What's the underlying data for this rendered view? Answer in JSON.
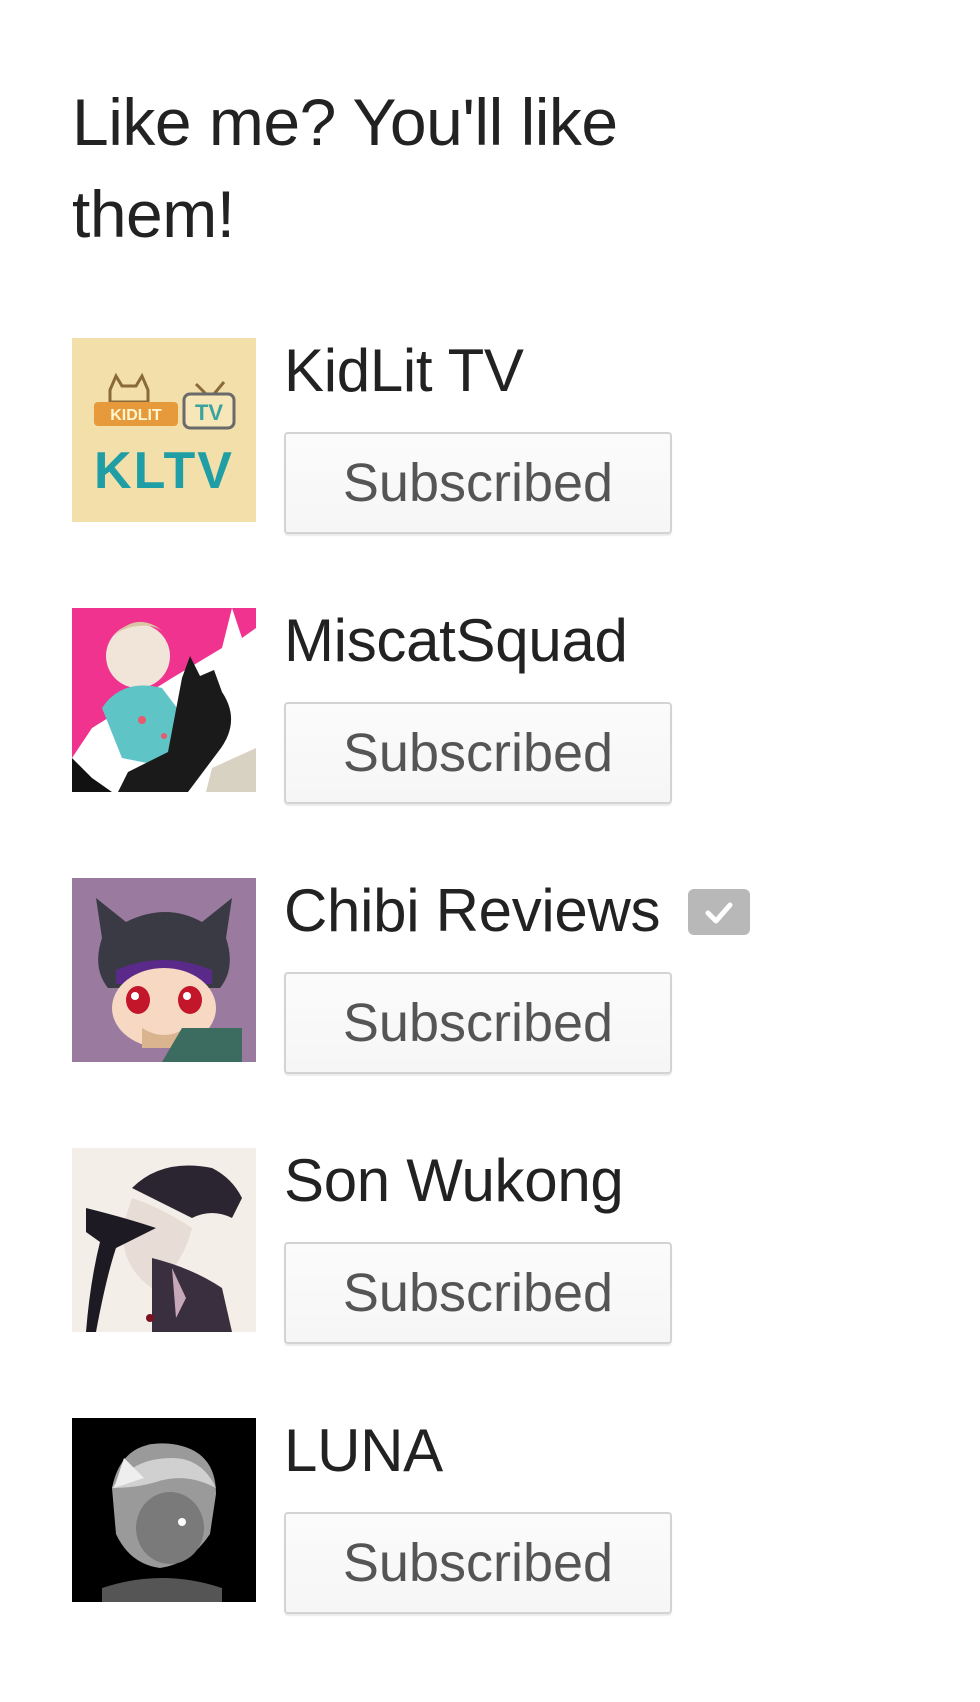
{
  "section": {
    "title": "Like me? You'll like them!"
  },
  "channels": [
    {
      "name": "KidLit TV",
      "button_label": "Subscribed",
      "verified": false,
      "avatar_icon": "kltv-logo-avatar"
    },
    {
      "name": "MiscatSquad",
      "button_label": "Subscribed",
      "verified": false,
      "avatar_icon": "anime-girl-cat-avatar"
    },
    {
      "name": "Chibi Reviews",
      "button_label": "Subscribed",
      "verified": true,
      "avatar_icon": "chibi-character-avatar"
    },
    {
      "name": "Son Wukong",
      "button_label": "Subscribed",
      "verified": false,
      "avatar_icon": "sketch-character-avatar"
    },
    {
      "name": "LUNA",
      "button_label": "Subscribed",
      "verified": false,
      "avatar_icon": "grayscale-character-avatar"
    }
  ],
  "colors": {
    "heading_text": "#222222",
    "button_text": "#555555",
    "button_border": "#d3d3d3",
    "verified_badge": "#b8b8b8"
  }
}
